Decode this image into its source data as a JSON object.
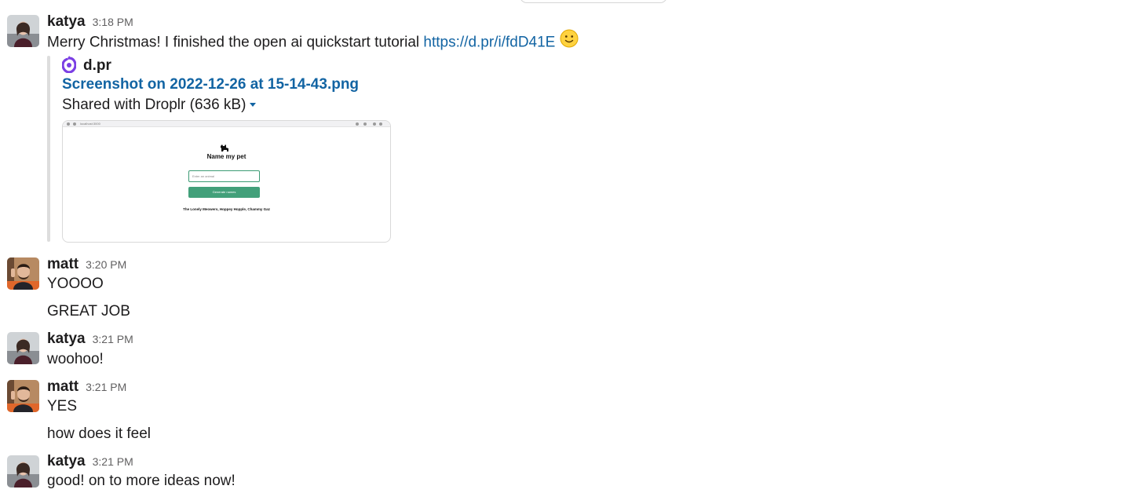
{
  "messages": [
    {
      "author": "katya",
      "time": "3:18 PM",
      "text": "Merry Christmas! I finished the open ai quickstart tutorial ",
      "link": "https://d.pr/i/fdD41E",
      "emoji": "slightly-smiling-face",
      "attachment": {
        "service": "d.pr",
        "title": "Screenshot on 2022-12-26 at 15-14-43.png",
        "shared": "Shared with Droplr (636 kB)",
        "preview": {
          "url": "localhost:3000",
          "heading": "Name my pet",
          "input_placeholder": "Enter an animal",
          "button": "Generate names",
          "result": "The Lonely Meowers, Hoppey Hopple, Chammy Gaz"
        }
      }
    },
    {
      "author": "matt",
      "time": "3:20 PM",
      "lines": [
        "YOOOO",
        "GREAT JOB"
      ]
    },
    {
      "author": "katya",
      "time": "3:21 PM",
      "lines": [
        "woohoo!"
      ]
    },
    {
      "author": "matt",
      "time": "3:21 PM",
      "lines": [
        "YES",
        "how does it feel"
      ]
    },
    {
      "author": "katya",
      "time": "3:21 PM",
      "lines": [
        "good! on to more ideas now!"
      ]
    }
  ],
  "colors": {
    "link": "#1264a3",
    "text": "#1d1c1d",
    "timestamp": "#616061",
    "droplr_logo": "#7b3fe4",
    "preview_button": "#42a07a"
  }
}
